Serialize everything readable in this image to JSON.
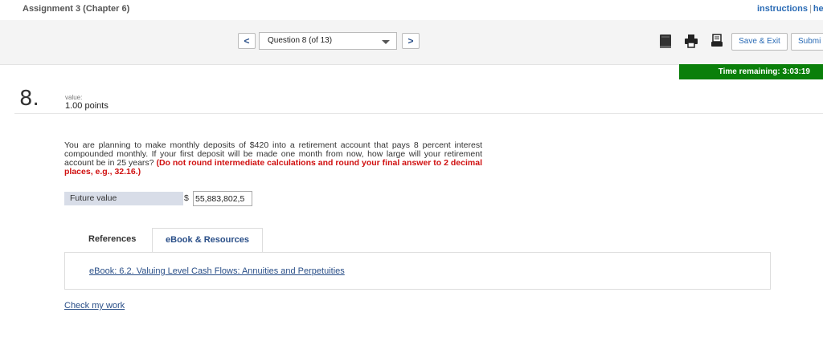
{
  "header": {
    "assignment_title": "Assignment 3 (Chapter 6)",
    "instructions_link": "instructions",
    "separator": "|",
    "help_link": "hel"
  },
  "nav": {
    "prev_label": "<",
    "next_label": ">",
    "question_select": "Question 8 (of 13)",
    "save_exit_label": "Save & Exit",
    "submit_label": "Submi"
  },
  "timer": {
    "text": "Time remaining: 3:03:19"
  },
  "question": {
    "number": "8.",
    "value_label": "value:",
    "points": "1.00 points",
    "text": "You are planning to make monthly deposits of $420 into a retirement account that pays 8 percent interest compounded monthly. If your first deposit will be made one month from now, how large will your retirement account be in 25 years?",
    "instruction": "(Do not round intermediate calculations and round your final answer to 2 decimal places, e.g., 32.16.)",
    "answer_label": "Future value",
    "currency": "$",
    "answer_value": "55,883,802,5"
  },
  "resources": {
    "tab_references": "References",
    "tab_ebook": "eBook & Resources",
    "ebook_link": "eBook: 6.2. Valuing Level Cash Flows: Annuities and Perpetuities"
  },
  "footer": {
    "check_work": "Check my work"
  },
  "colors": {
    "timer_bg": "#0a7f0a",
    "accent": "#2a6bb5",
    "emphasis": "#d01010"
  },
  "icons": [
    "ebook-icon",
    "print-icon",
    "printer-alt-icon",
    "chevron-down-icon"
  ]
}
